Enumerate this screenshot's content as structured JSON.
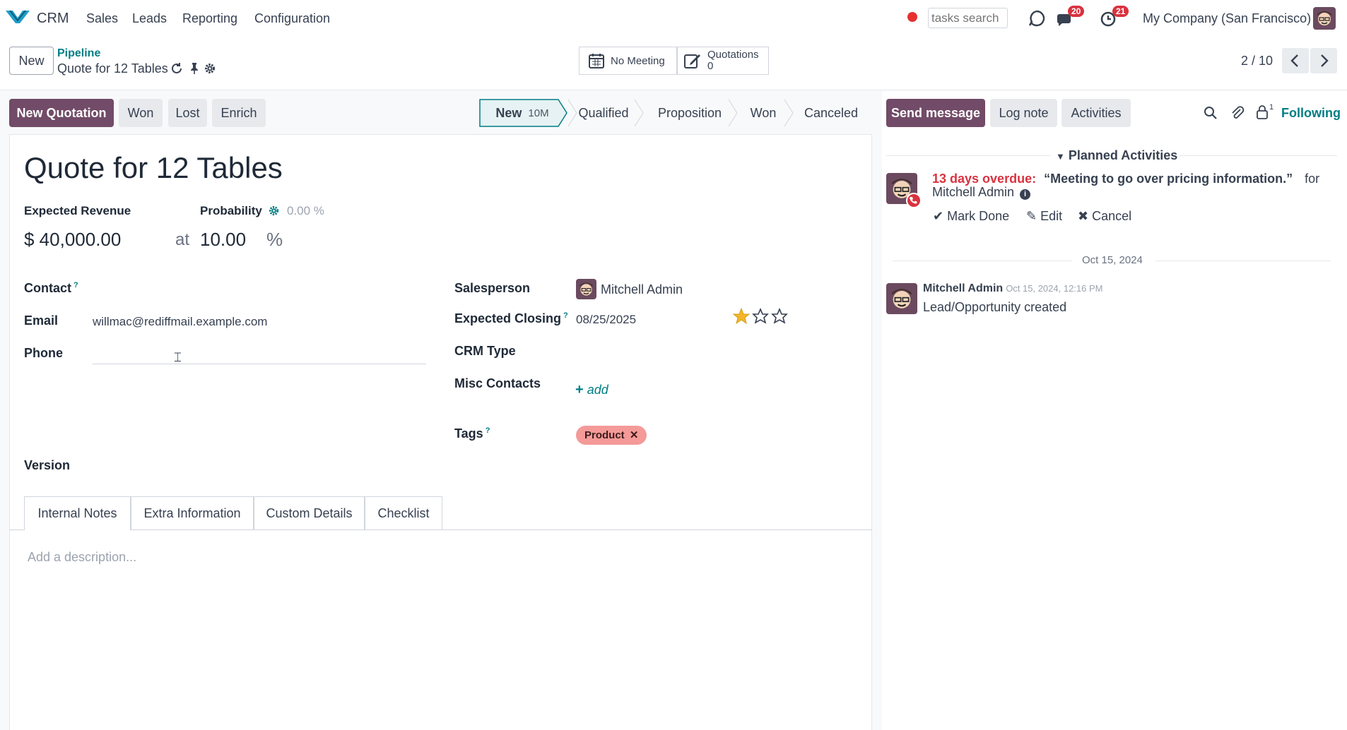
{
  "nav": {
    "app_name": "CRM",
    "menu": [
      "Sales",
      "Leads",
      "Reporting",
      "Configuration"
    ],
    "search_placeholder": "tasks search",
    "messages_count": "20",
    "activities_count": "21",
    "company": "My Company (San Francisco)",
    "accent": "#714b67"
  },
  "control": {
    "new_label": "New",
    "breadcrumb_parent": "Pipeline",
    "breadcrumb_current": "Quote for 12 Tables",
    "smart_meeting": "No Meeting",
    "smart_quotations_label": "Quotations",
    "smart_quotations_count": "0",
    "pager": "2 / 10"
  },
  "actions": {
    "new_quotation": "New Quotation",
    "won": "Won",
    "lost": "Lost",
    "enrich": "Enrich"
  },
  "stages": {
    "items": [
      "New",
      "Qualified",
      "Proposition",
      "Won",
      "Canceled"
    ],
    "current_duration": "10M"
  },
  "form": {
    "title": "Quote for 12 Tables",
    "expected_revenue_label": "Expected Revenue",
    "probability_label": "Probability",
    "auto_probability": "0.00 %",
    "revenue_value": "$ 40,000.00",
    "at": "at",
    "probability_value": "10.00",
    "percent": "%",
    "contact_label": "Contact",
    "email_label": "Email",
    "email_value": "willmac@rediffmail.example.com",
    "phone_label": "Phone",
    "salesperson_label": "Salesperson",
    "salesperson_value": "Mitchell Admin",
    "expected_closing_label": "Expected Closing",
    "expected_closing_value": "08/25/2025",
    "priority_stars": 1,
    "crm_type_label": "CRM Type",
    "misc_contacts_label": "Misc Contacts",
    "add_label": "add",
    "tags_label": "Tags",
    "tag_value": "Product",
    "version_label": "Version",
    "question_mark": "?",
    "tabs": [
      "Internal Notes",
      "Extra Information",
      "Custom Details",
      "Checklist"
    ],
    "description_placeholder": "Add a description..."
  },
  "chatter": {
    "send_message": "Send message",
    "log_note": "Log note",
    "activities": "Activities",
    "followers_count": "1",
    "following": "Following",
    "planned_title": "Planned Activities",
    "overdue_text": "13 days overdue:",
    "activity_summary": "“Meeting to go over pricing information.”",
    "for_text": "for",
    "assignee": "Mitchell Admin",
    "mark_done": "Mark Done",
    "edit": "Edit",
    "cancel": "Cancel",
    "date_separator": "Oct 15, 2024",
    "msg_author": "Mitchell Admin",
    "msg_date": "Oct 15, 2024, 12:16 PM",
    "msg_body": "Lead/Opportunity created"
  }
}
